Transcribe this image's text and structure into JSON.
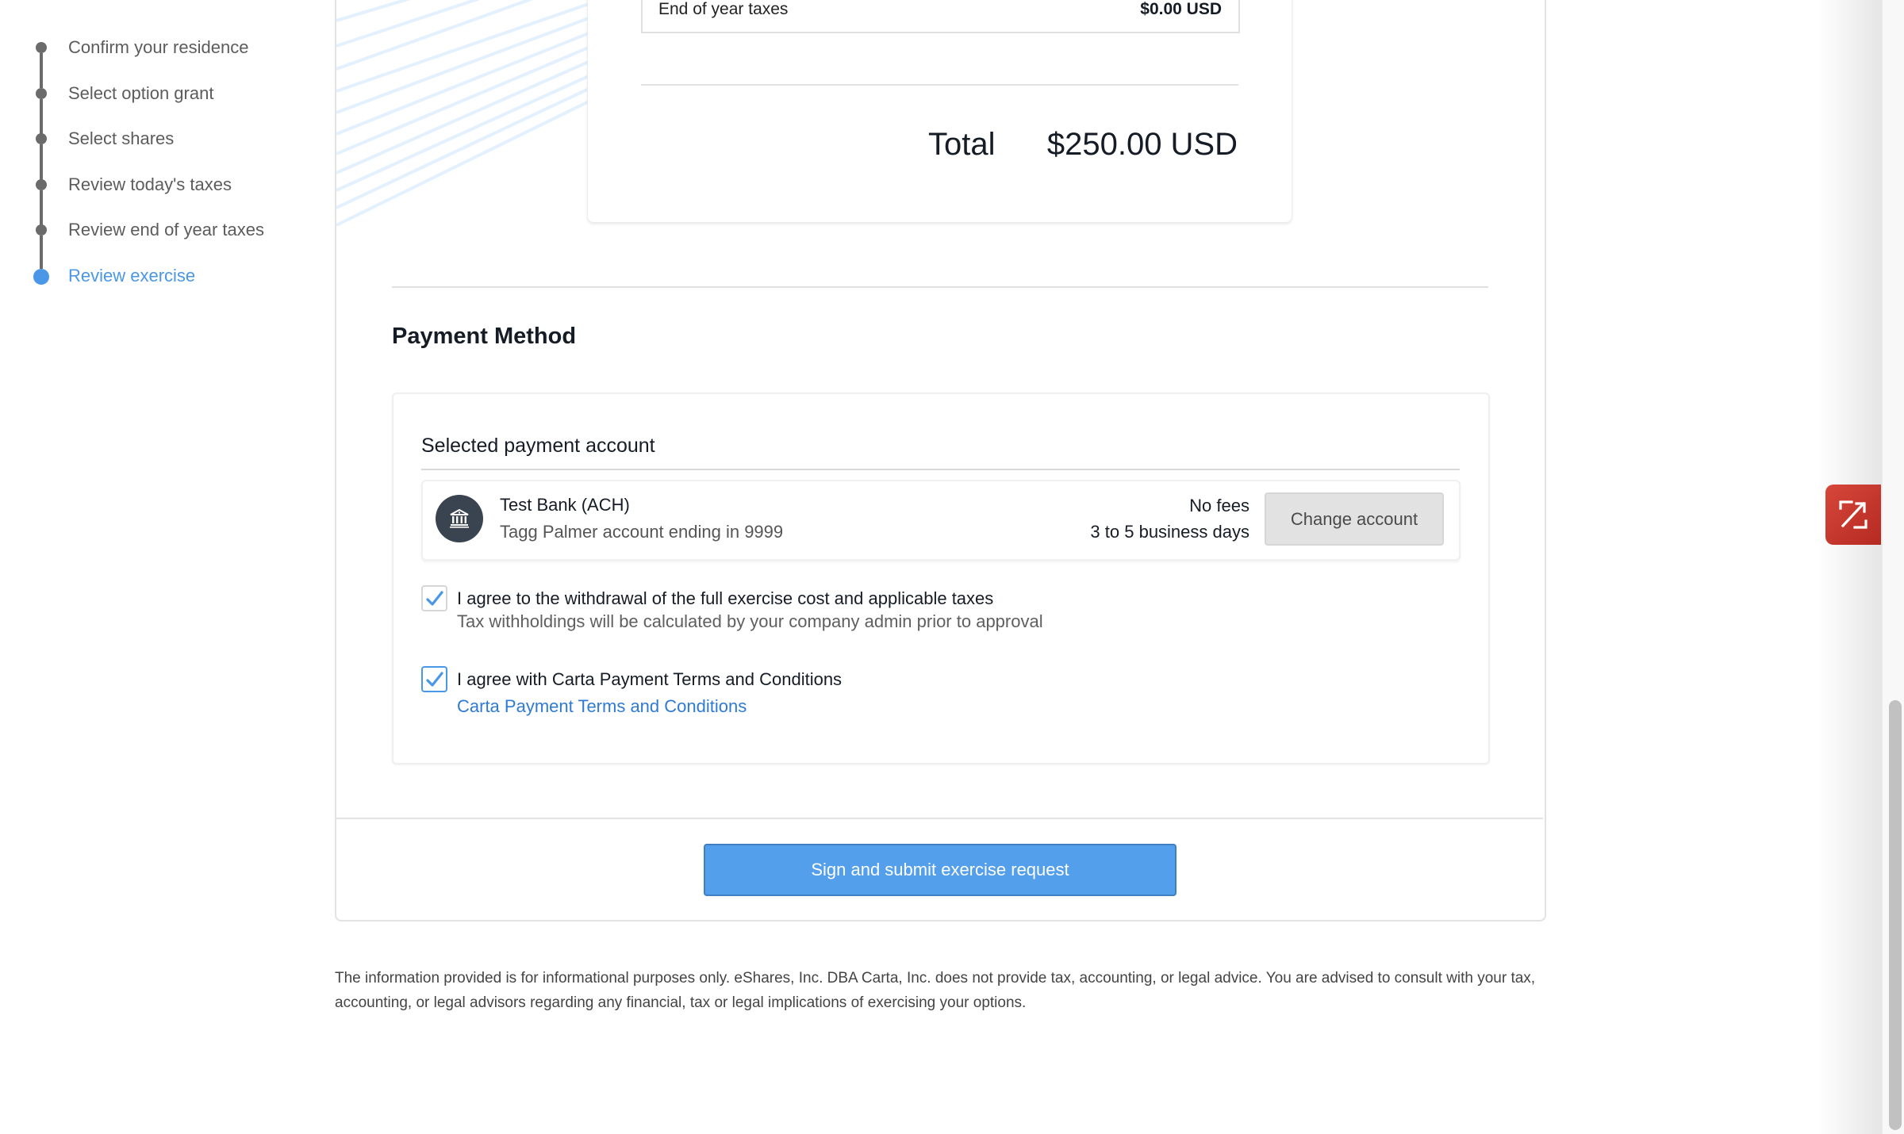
{
  "stepper": {
    "steps": [
      {
        "label": "Confirm your residence",
        "state": "complete"
      },
      {
        "label": "Select option grant",
        "state": "complete"
      },
      {
        "label": "Select shares",
        "state": "complete"
      },
      {
        "label": "Review today's taxes",
        "state": "complete"
      },
      {
        "label": "Review end of year taxes",
        "state": "complete"
      },
      {
        "label": "Review exercise",
        "state": "active"
      }
    ],
    "active_color": "#4a97e8"
  },
  "summary": {
    "row_label": "End of year taxes",
    "row_value": "$0.00 USD",
    "total_label": "Total",
    "total_value": "$250.00 USD"
  },
  "payment": {
    "section_title": "Payment Method",
    "subtitle": "Selected payment account",
    "account": {
      "icon": "bank-icon",
      "name": "Test Bank (ACH)",
      "description": "Tagg Palmer account ending in 9999",
      "fees": "No fees",
      "timing": "3 to 5 business days",
      "change_label": "Change account"
    },
    "agreements": [
      {
        "label": "I agree to the withdrawal of the full exercise cost and applicable taxes",
        "sublabel": "Tax withholdings will be calculated by your company admin prior to approval",
        "checked": true
      },
      {
        "label": "I agree with Carta Payment Terms and Conditions",
        "link": "Carta Payment Terms and Conditions",
        "checked": true
      }
    ]
  },
  "footer": {
    "submit_label": "Sign and submit exercise request",
    "submit_color": "#539feb",
    "disclaimer": "The information provided is for informational purposes only. eShares, Inc. DBA Carta, Inc. does not provide tax, accounting, or legal advice. You are advised to consult with your tax, accounting, or legal advisors regarding any financial, tax or legal implications of exercising your options."
  },
  "widget": {
    "icon": "expand-z-icon",
    "color": "#c8362c"
  }
}
